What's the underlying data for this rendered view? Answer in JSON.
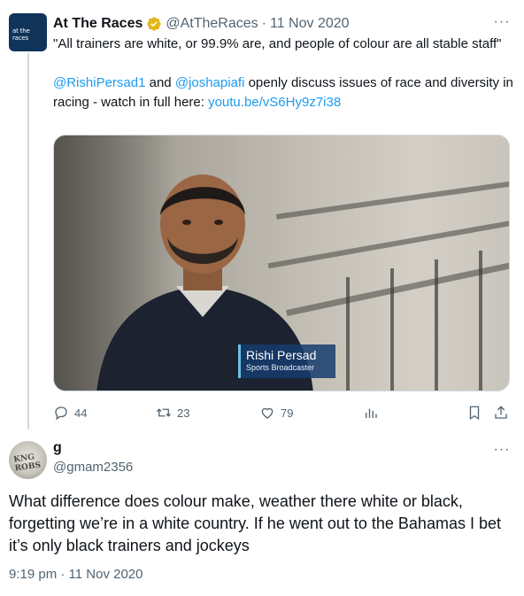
{
  "tweet": {
    "author_name": "At The Races",
    "author_handle": "@AtTheRaces",
    "separator": "·",
    "date": "11 Nov 2020",
    "avatar_text": "at the races",
    "text_quote": "\"All trainers are white, or 99.9% are, and people of colour are all stable staff\"",
    "mention1": "@RishiPersad1",
    "and_word": " and ",
    "mention2": "@joshapiafi",
    "text_rest_a": " openly discuss issues of race and diversity in racing - watch in full here: ",
    "link": "youtu.be/vS6Hy9z7i38",
    "video_caption_name": "Rishi Persad",
    "video_caption_role": "Sports Broadcaster",
    "replies": "44",
    "retweets": "23",
    "likes": "79",
    "more_label": "···"
  },
  "reply": {
    "author_name": "g",
    "author_handle": "@gmam2356",
    "avatar_text": "KNG ROBS",
    "text": "What difference does colour make, weather there white or black, forgetting we’re in a white country. If he went out to the Bahamas I bet it’s only black trainers and jockeys",
    "timestamp": "9:19 pm · 11 Nov 2020",
    "more_label": "···"
  },
  "colors": {
    "text": "#0f1419",
    "secondary": "#536471",
    "link": "#1d9bf0",
    "verified_gold": "#e2b719"
  },
  "icons": [
    "reply-icon",
    "retweet-icon",
    "like-icon",
    "views-icon",
    "bookmark-icon",
    "share-icon",
    "verified-badge-icon",
    "more-icon"
  ]
}
